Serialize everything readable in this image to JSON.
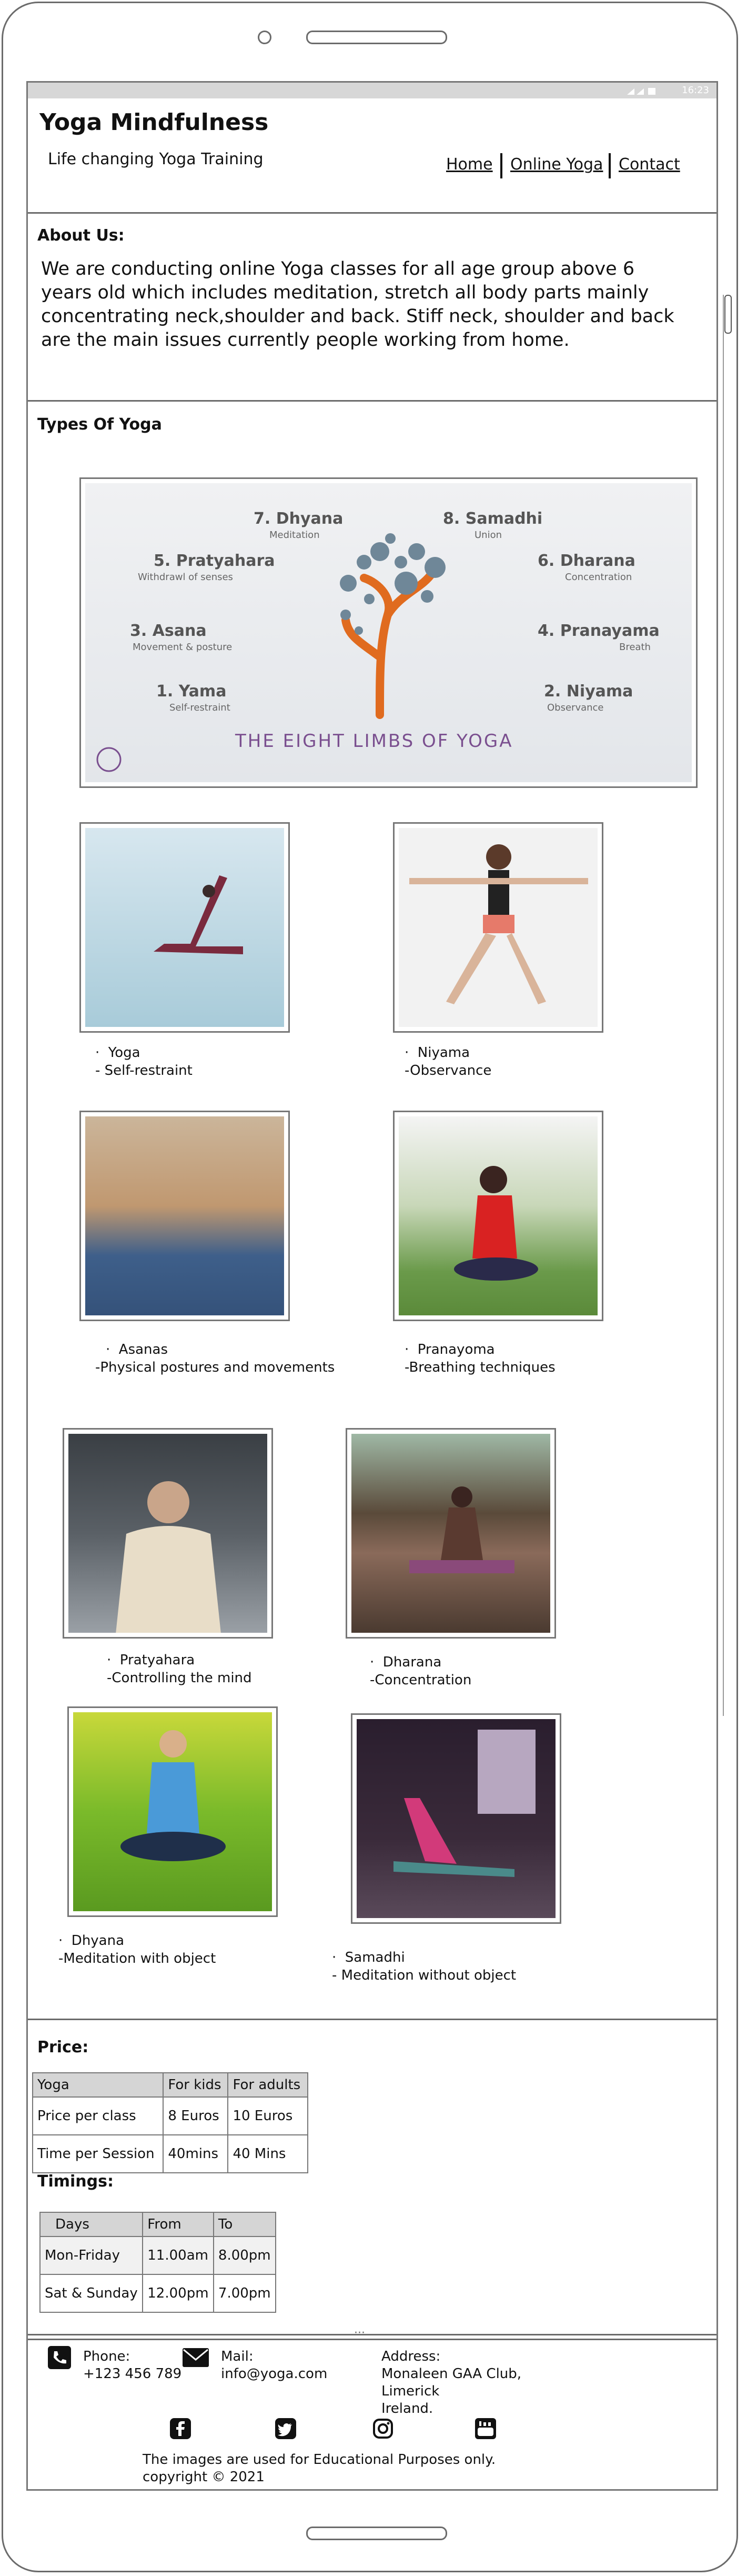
{
  "status": {
    "time": "16:23"
  },
  "header": {
    "title": "Yoga Mindfulness",
    "tagline": "Life changing Yoga Training"
  },
  "nav": {
    "items": [
      "Home",
      "Online Yoga",
      "Contact"
    ]
  },
  "about": {
    "heading": "About Us:",
    "text": "We are conducting online Yoga classes for all age group above 6 years old which includes meditation, stretch all body parts mainly concentrating neck,shoulder and back. Stiff neck, shoulder and back are the main issues currently people working from home."
  },
  "types": {
    "heading": "Types Of Yoga",
    "banner": {
      "title": "THE EIGHT LIMBS OF YOGA",
      "limbs": [
        {
          "name": "7. Dhyana",
          "sub": "Meditation"
        },
        {
          "name": "8. Samadhi",
          "sub": "Union"
        },
        {
          "name": "5. Pratyahara",
          "sub": "Withdrawl of senses"
        },
        {
          "name": "6. Dharana",
          "sub": "Concentration"
        },
        {
          "name": "3. Asana",
          "sub": "Movement & posture"
        },
        {
          "name": "4. Pranayama",
          "sub": "Breath"
        },
        {
          "name": "1. Yama",
          "sub": "Self-restraint"
        },
        {
          "name": "2. Niyama",
          "sub": "Observance"
        }
      ]
    },
    "items": [
      {
        "name": "Yoga",
        "desc": "- Self-restraint"
      },
      {
        "name": "Niyama",
        "desc": "-Observance"
      },
      {
        "name": "Asanas",
        "desc": "-Physical postures and movements"
      },
      {
        "name": "Pranayoma",
        "desc": "-Breathing techniques"
      },
      {
        "name": "Pratyahara",
        "desc": "-Controlling the mind"
      },
      {
        "name": "Dharana",
        "desc": "-Concentration"
      },
      {
        "name": "Dhyana",
        "desc": "-Meditation with object"
      },
      {
        "name": "Samadhi",
        "desc": "- Meditation without object"
      }
    ]
  },
  "price": {
    "heading": "Price:",
    "header": [
      "Yoga",
      "For kids",
      "For adults"
    ],
    "rows": [
      [
        "Price per class",
        "8 Euros",
        "10 Euros"
      ],
      [
        "Time per Session",
        "40mins",
        "40 Mins"
      ]
    ]
  },
  "timings": {
    "heading": "Timings:",
    "header": [
      "Days",
      "From",
      "To"
    ],
    "rows": [
      [
        "Mon-Friday",
        "11.00am",
        "8.00pm"
      ],
      [
        "Sat & Sunday",
        "12.00pm",
        "7.00pm"
      ]
    ]
  },
  "footer": {
    "phone_label": "Phone:",
    "phone": "+123 456 789",
    "mail_label": "Mail:",
    "mail": "info@yoga.com",
    "address_label": "Address:",
    "address_lines": [
      "Monaleen GAA Club,",
      "Limerick",
      "Ireland."
    ],
    "note": "The images are used for Educational Purposes only.",
    "copyright": "copyright © 2021",
    "social": [
      "facebook-icon",
      "twitter-icon",
      "instagram-icon",
      "youtube-icon"
    ]
  },
  "colors": {
    "accent": "#e06b1f",
    "frame": "#6b6b6b",
    "table_header": "#d5d5d5"
  }
}
